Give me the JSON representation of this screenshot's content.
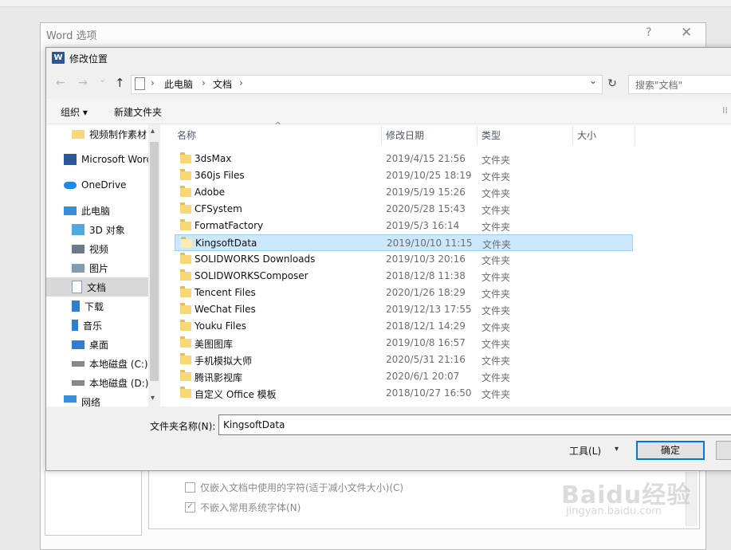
{
  "background_app": {
    "dialog_title": "Word 选项",
    "help_glyph": "?",
    "close_glyph": "✕",
    "options": [
      {
        "label": "仅嵌入文档中使用的字符(适于减小文件大小)(C)",
        "checked": false
      },
      {
        "label": "不嵌入常用系统字体(N)",
        "checked": true
      }
    ]
  },
  "dialog": {
    "title": "修改位置",
    "app_icon_letter": "W"
  },
  "nav": {
    "back_glyph": "←",
    "forward_glyph": "→",
    "recent_glyph": "⌄",
    "up_glyph": "↑",
    "breadcrumb": [
      "此电脑",
      "文档"
    ],
    "separator": "›",
    "dropdown_glyph": "⌄",
    "refresh_glyph": "↻",
    "search_placeholder": "搜索\"文档\""
  },
  "toolbar": {
    "organize_label": "组织 ▾",
    "new_folder_label": "新建文件夹",
    "view_glyph": "⁞⁞"
  },
  "sidebar": {
    "items": [
      {
        "label": "视频制作素材",
        "icon": "folder-icon",
        "indent": 1
      },
      {
        "label": "Microsoft Word",
        "icon": "word-icon",
        "indent": 0
      },
      {
        "label": "OneDrive",
        "icon": "cloud-icon",
        "indent": 0
      },
      {
        "label": "此电脑",
        "icon": "computer-icon",
        "indent": 0
      },
      {
        "label": "3D 对象",
        "icon": "cube-icon",
        "indent": 1
      },
      {
        "label": "视频",
        "icon": "video-icon",
        "indent": 1
      },
      {
        "label": "图片",
        "icon": "picture-icon",
        "indent": 1
      },
      {
        "label": "文档",
        "icon": "document-icon",
        "indent": 1,
        "selected": true
      },
      {
        "label": "下载",
        "icon": "download-icon",
        "indent": 1
      },
      {
        "label": "音乐",
        "icon": "music-icon",
        "indent": 1
      },
      {
        "label": "桌面",
        "icon": "desktop-icon",
        "indent": 1
      },
      {
        "label": "本地磁盘 (C:)",
        "icon": "drive-icon",
        "indent": 1
      },
      {
        "label": "本地磁盘 (D:)",
        "icon": "drive-icon",
        "indent": 1
      },
      {
        "label": "网络",
        "icon": "network-icon",
        "indent": 0
      }
    ],
    "scroll_up_glyph": "▴",
    "scroll_down_glyph": "▾"
  },
  "file_list": {
    "columns": [
      "名称",
      "修改日期",
      "类型",
      "大小"
    ],
    "sort_glyph": "^",
    "rows": [
      {
        "name": "3dsMax",
        "date": "2019/4/15 21:56",
        "type": "文件夹"
      },
      {
        "name": "360js Files",
        "date": "2019/10/25 18:19",
        "type": "文件夹"
      },
      {
        "name": "Adobe",
        "date": "2019/5/19 15:26",
        "type": "文件夹"
      },
      {
        "name": "CFSystem",
        "date": "2020/5/28 15:43",
        "type": "文件夹"
      },
      {
        "name": "FormatFactory",
        "date": "2019/5/3 16:14",
        "type": "文件夹"
      },
      {
        "name": "KingsoftData",
        "date": "2019/10/10 11:15",
        "type": "文件夹",
        "selected": true
      },
      {
        "name": "SOLIDWORKS Downloads",
        "date": "2019/10/3 20:16",
        "type": "文件夹"
      },
      {
        "name": "SOLIDWORKSComposer",
        "date": "2018/12/8 11:38",
        "type": "文件夹"
      },
      {
        "name": "Tencent Files",
        "date": "2020/1/26 18:29",
        "type": "文件夹"
      },
      {
        "name": "WeChat Files",
        "date": "2019/12/13 17:55",
        "type": "文件夹"
      },
      {
        "name": "Youku Files",
        "date": "2018/12/1 14:29",
        "type": "文件夹"
      },
      {
        "name": "美图图库",
        "date": "2019/10/8 16:57",
        "type": "文件夹"
      },
      {
        "name": "手机模拟大师",
        "date": "2020/5/31 21:16",
        "type": "文件夹"
      },
      {
        "name": "腾讯影视库",
        "date": "2020/6/1 20:07",
        "type": "文件夹"
      },
      {
        "name": "自定义 Office 模板",
        "date": "2018/10/27 16:50",
        "type": "文件夹"
      }
    ]
  },
  "footer": {
    "folder_name_label": "文件夹名称(N):",
    "folder_name_value": "KingsoftData",
    "tools_label": "工具(L)",
    "tools_arrow": "▾",
    "ok_label": "确定"
  },
  "watermark": {
    "brand": "Baidu经验",
    "url": "jingyan.baidu.com"
  },
  "colors": {
    "selection": "#cce8ff",
    "selection_border": "#99d1ff",
    "folder": "#f8d775",
    "accent": "#0078d7",
    "word_blue": "#2b579a"
  }
}
